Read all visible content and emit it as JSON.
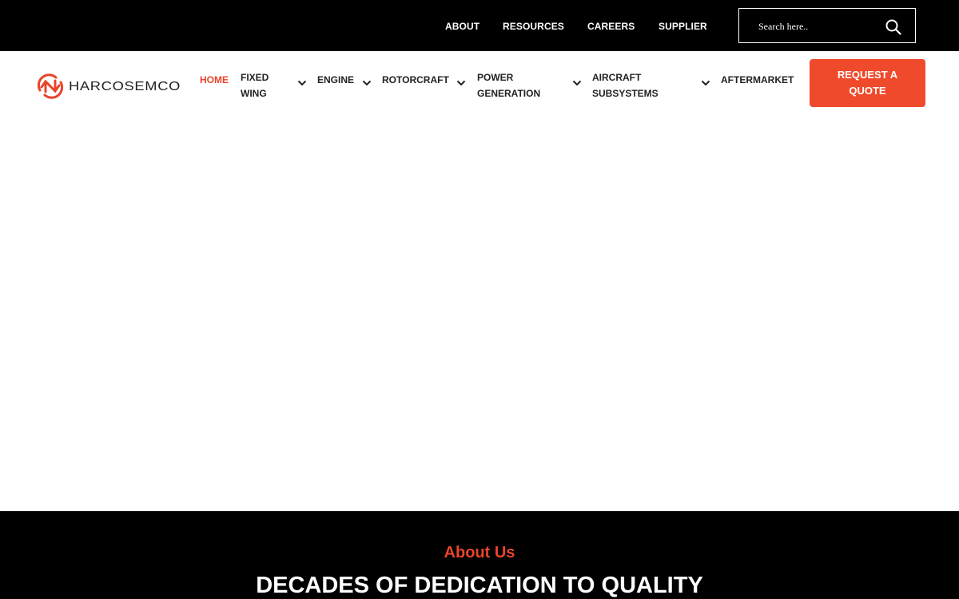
{
  "topbar": {
    "links": [
      "ABOUT",
      "RESOURCES",
      "CAREERS",
      "SUPPLIER"
    ],
    "search": {
      "placeholder": "Search here..",
      "icon": "search-icon"
    }
  },
  "brand": {
    "logo_text": "HarcoSemco",
    "colors": {
      "accent": "#e8442a",
      "cta": "#f04a2c",
      "dark": "#000000"
    }
  },
  "nav": {
    "items": [
      {
        "label": "HOME",
        "active": true,
        "dropdown": false
      },
      {
        "label": "FIXED WING",
        "active": false,
        "dropdown": true
      },
      {
        "label": "ENGINE",
        "active": false,
        "dropdown": true
      },
      {
        "label": "ROTORCRAFT",
        "active": false,
        "dropdown": true
      },
      {
        "label": "POWER GENERATION",
        "active": false,
        "dropdown": true
      },
      {
        "label": "AIRCRAFT SUBSYSTEMS",
        "active": false,
        "dropdown": true
      },
      {
        "label": "AFTERMARKET",
        "active": false,
        "dropdown": false
      }
    ],
    "cta_label": "REQUEST A QUOTE"
  },
  "about": {
    "eyebrow": "About Us",
    "title": "DECADES OF DEDICATION TO QUALITY"
  }
}
